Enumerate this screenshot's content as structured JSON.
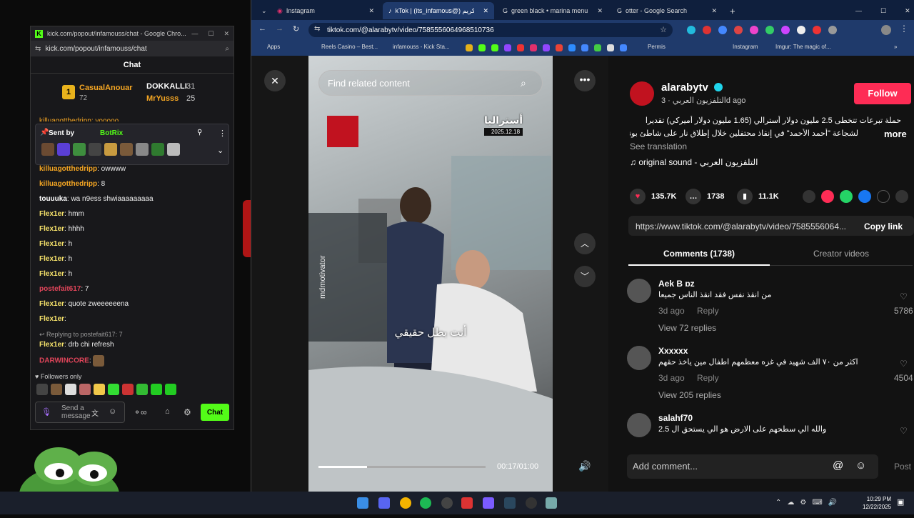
{
  "kick": {
    "window_title": "kick.com/popout/infamouss/chat - Google Chro...",
    "address": "kick.com/popout/infamouss/chat",
    "header": "Chat",
    "leaderboard": [
      {
        "rank": "1",
        "name": "CasualAnouar",
        "count": "72"
      },
      {
        "name": "DOKKALLI",
        "count": "31"
      },
      {
        "name": "MrYusss",
        "count": "25"
      }
    ],
    "clipped_line": "killuagotthedripp: yooooo",
    "pinned": {
      "label": "Sent by",
      "bot": "BotRix"
    },
    "messages": [
      {
        "user": "killuagotthedripp",
        "text": ": owwww",
        "color": "#f5a623"
      },
      {
        "user": "killuagotthedripp",
        "text": ": 8",
        "color": "#f5a623"
      },
      {
        "user": "touuuka",
        "text": ": wa n9ess shwiaaaaaaaaa",
        "color": "#ffffff"
      },
      {
        "user": "Flex1er",
        "text": ": hmm",
        "color": "#f7e36b"
      },
      {
        "user": "Flex1er",
        "text": ": hhhh",
        "color": "#f7e36b"
      },
      {
        "user": "Flex1er",
        "text": ": h",
        "color": "#f7e36b"
      },
      {
        "user": "Flex1er",
        "text": ": h",
        "color": "#f7e36b"
      },
      {
        "user": "Flex1er",
        "text": ": h",
        "color": "#f7e36b"
      },
      {
        "user": "postefait617",
        "text": ": 7",
        "color": "#e0455a"
      },
      {
        "user": "Flex1er",
        "text": ": quote zweeeeeena",
        "color": "#f7e36b"
      },
      {
        "user": "Flex1er",
        "text": ":",
        "color": "#f7e36b"
      }
    ],
    "reply_hint": "Replying to postefait617: 7",
    "reply_msg": {
      "user": "Flex1er",
      "text": ": drb chi refresh"
    },
    "last_msg": {
      "user": "DARWINCORE",
      "text": ":"
    },
    "followers_only": "Followers only",
    "input_placeholder": "Send a message",
    "chat_button": "Chat"
  },
  "chrome": {
    "tabs": [
      "Instagram",
      "kTok | (its_infamous@) كريم",
      "green black • marina menu - G",
      "otter - Google Search"
    ],
    "url": "tiktok.com/@alarabytv/video/7585556064968510736",
    "bookmarks": [
      "Apps",
      "Reels Casino – Best...",
      "infamouss - Kick Sta...",
      "Permis",
      "Instagram",
      "Imgur: The magic of..."
    ]
  },
  "video": {
    "search_placeholder": "Find related content",
    "location": "أستراليا",
    "date": "2025.12.18",
    "watermark": "mdmotivator",
    "subtitle": "أنت بطل حقيقي",
    "time": "00:17/01:00",
    "progress": 0.29
  },
  "post": {
    "author": "alarabytv",
    "channel": "التلفزيون العربي",
    "ago": "3d ago",
    "follow": "Follow",
    "caption_line1": "حملة تبرعات تتخطى 2.5 مليون دولار أسترالي (1.65 مليون دولار أميركي) تقديرا",
    "caption_line2": "لشجاعة \"أحمد الأحمد\" في إنقاذ محتفلين خلال إطلاق نار على شاطئ بوندي...",
    "more": "more",
    "see_translation": "See translation",
    "sound": "original sound - التلفزيون العربي",
    "likes": "135.7K",
    "comments_count": "1738",
    "saves": "11.1K",
    "link": "https://www.tiktok.com/@alarabytv/video/7585556064...",
    "copy_link": "Copy link",
    "tab_comments": "Comments (1738)",
    "tab_creator": "Creator videos",
    "comments": [
      {
        "user": "Aek B ɒz",
        "text": "من انقذ نفس فقد انقذ الناس جميعا",
        "ago": "3d ago",
        "reply": "Reply",
        "replies": "View 72 replies",
        "likes": "5786"
      },
      {
        "user": "Xxxxxx",
        "text": "اكثر من ٧٠ الف شهيد في غزه معظمهم اطفال مين ياخذ حقهم",
        "ago": "3d ago",
        "reply": "Reply",
        "replies": "View 205 replies",
        "likes": "4504"
      },
      {
        "user": "salahf70",
        "text": "والله الي سطحهم على الارض هو الي يستحق ال 2.5",
        "ago": "",
        "reply": "",
        "replies": "",
        "likes": ""
      }
    ],
    "add_comment": "Add comment...",
    "post_btn": "Post"
  },
  "taskbar": {
    "time": "10:29 PM",
    "date": "12/22/2025"
  }
}
